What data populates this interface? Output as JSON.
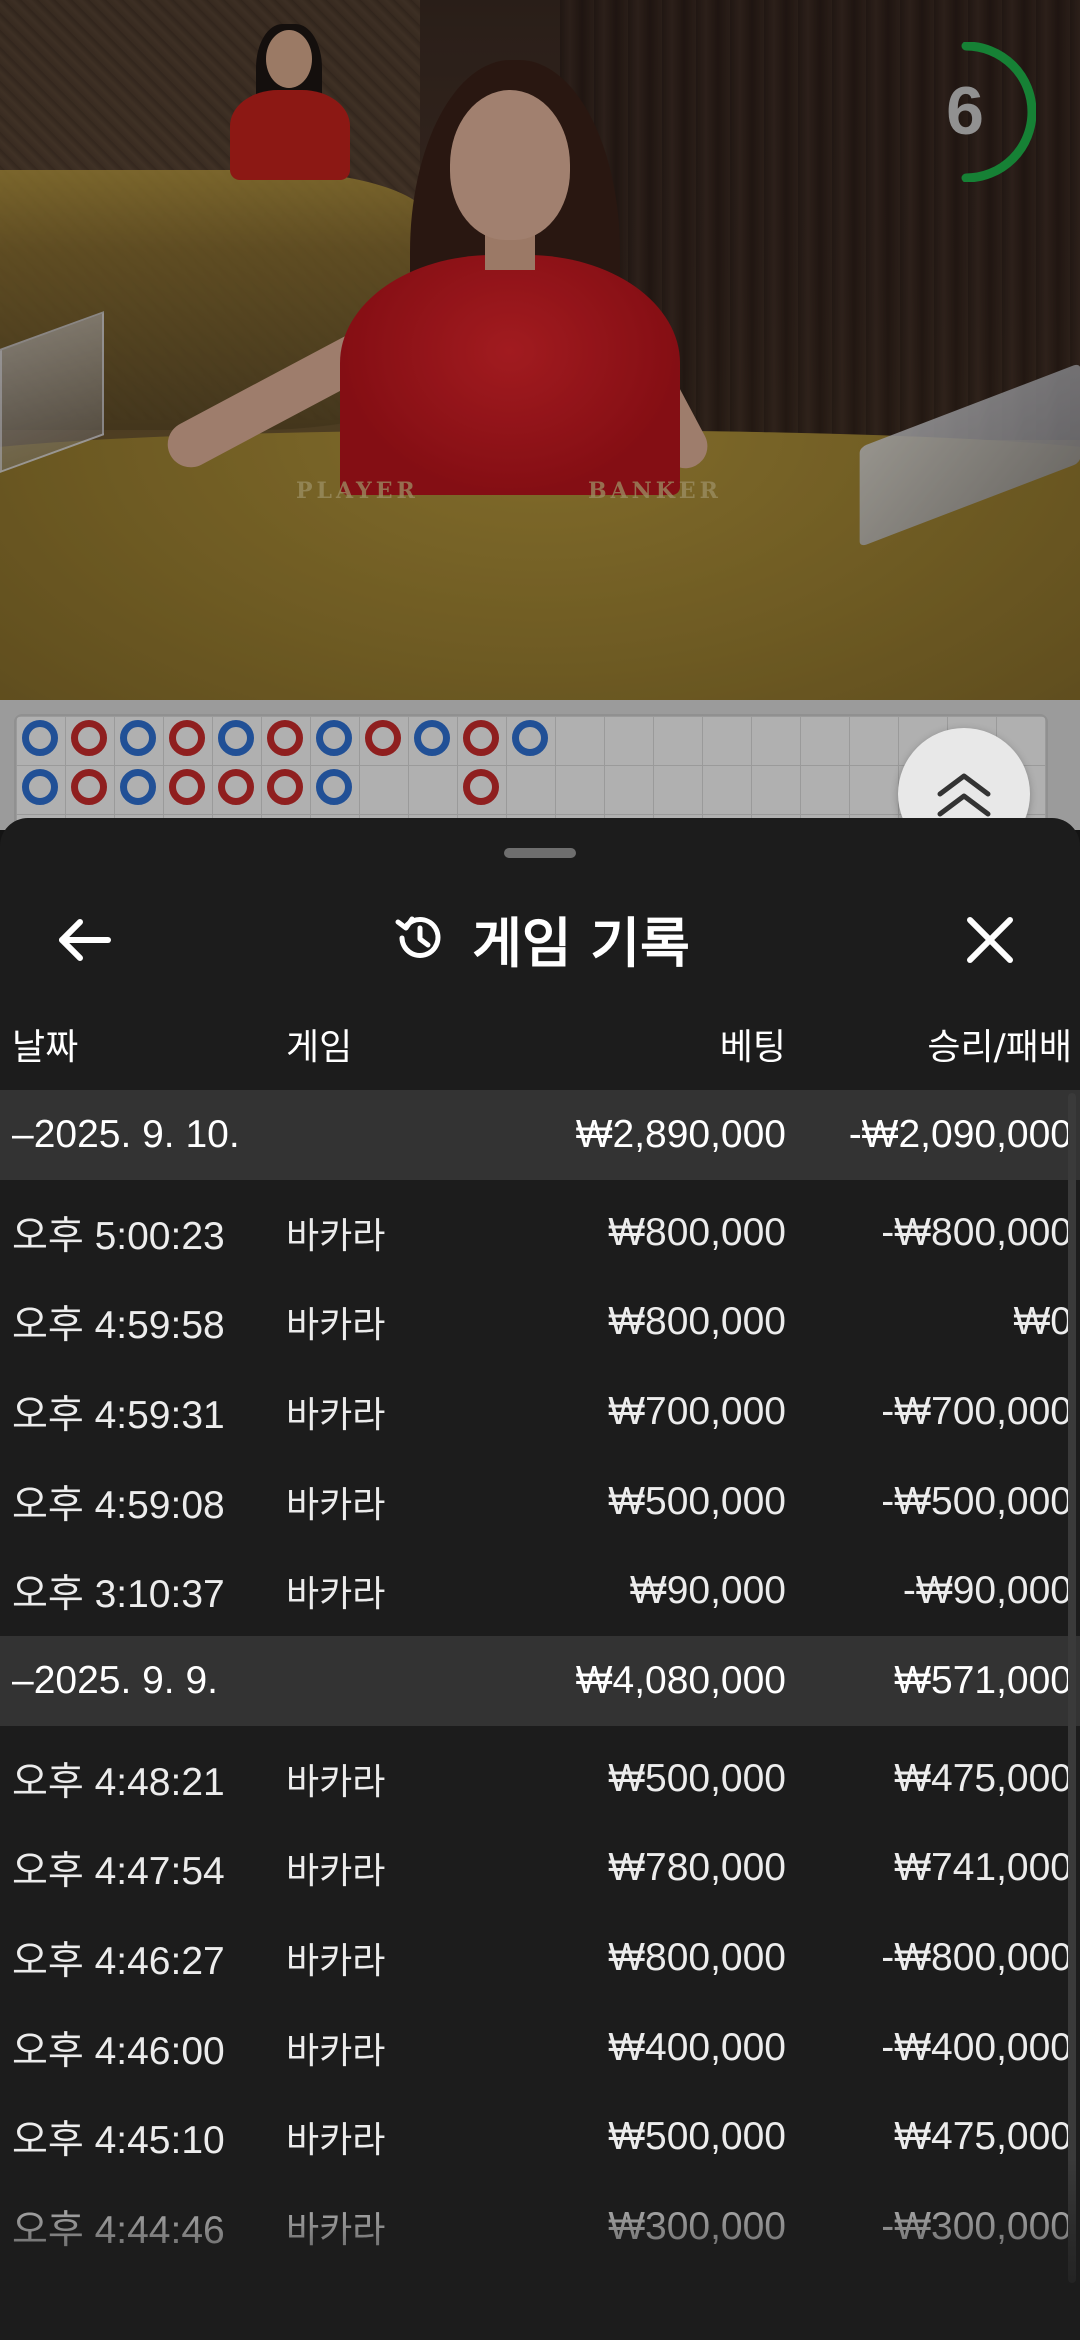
{
  "video": {
    "countdown": "6",
    "felt_labels": [
      "PLAYER",
      "BANKER"
    ]
  },
  "bead_road": {
    "player_color": "#2f6fd0",
    "banker_color": "#c62b2b",
    "top_row": [
      "P",
      "B",
      "P",
      "B",
      "P",
      "B",
      "P",
      "B",
      "P",
      "B",
      "P"
    ],
    "second_row": [
      "P",
      "B",
      "P",
      "B",
      "B",
      "B",
      "P",
      "",
      "",
      "B",
      ""
    ]
  },
  "sheet": {
    "title": "게임 기록",
    "title_icon": "history-icon",
    "back_icon": "arrow-left-icon",
    "close_icon": "close-icon",
    "columns": {
      "date": "날짜",
      "game": "게임",
      "bet": "베팅",
      "result": "승리/패배"
    },
    "groups": [
      {
        "date": "–2025. 9. 10.",
        "bet_total": "₩2,890,000",
        "result_total": "-₩2,090,000",
        "rows": [
          {
            "time": "오후 5:00:23",
            "game": "바카라",
            "bet": "₩800,000",
            "result": "-₩800,000"
          },
          {
            "time": "오후 4:59:58",
            "game": "바카라",
            "bet": "₩800,000",
            "result": "₩0"
          },
          {
            "time": "오후 4:59:31",
            "game": "바카라",
            "bet": "₩700,000",
            "result": "-₩700,000"
          },
          {
            "time": "오후 4:59:08",
            "game": "바카라",
            "bet": "₩500,000",
            "result": "-₩500,000"
          },
          {
            "time": "오후 3:10:37",
            "game": "바카라",
            "bet": "₩90,000",
            "result": "-₩90,000"
          }
        ]
      },
      {
        "date": "–2025. 9. 9.",
        "bet_total": "₩4,080,000",
        "result_total": "₩571,000",
        "rows": [
          {
            "time": "오후 4:48:21",
            "game": "바카라",
            "bet": "₩500,000",
            "result": "₩475,000"
          },
          {
            "time": "오후 4:47:54",
            "game": "바카라",
            "bet": "₩780,000",
            "result": "₩741,000"
          },
          {
            "time": "오후 4:46:27",
            "game": "바카라",
            "bet": "₩800,000",
            "result": "-₩800,000"
          },
          {
            "time": "오후 4:46:00",
            "game": "바카라",
            "bet": "₩400,000",
            "result": "-₩400,000"
          },
          {
            "time": "오후 4:45:10",
            "game": "바카라",
            "bet": "₩500,000",
            "result": "₩475,000"
          },
          {
            "time": "오후 4:44:46",
            "game": "바카라",
            "bet": "₩300,000",
            "result": "-₩300,000"
          }
        ]
      }
    ]
  }
}
